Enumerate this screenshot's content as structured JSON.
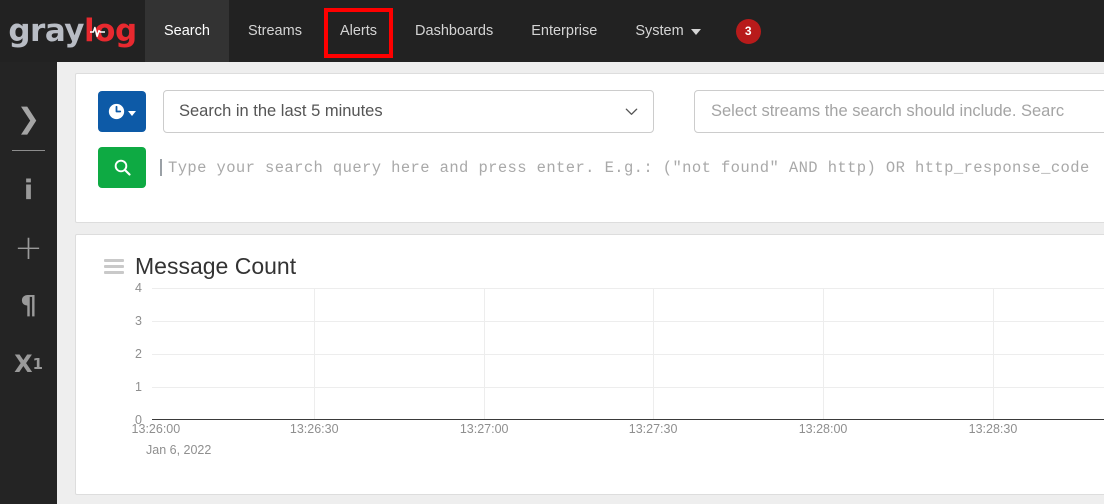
{
  "brand": {
    "name_part1": "gray",
    "name_part2": "log",
    "icon": "pulse-icon"
  },
  "nav": {
    "items": [
      {
        "label": "Search",
        "active": true,
        "annotated": false,
        "caret": false
      },
      {
        "label": "Streams",
        "active": false,
        "annotated": false,
        "caret": false
      },
      {
        "label": "Alerts",
        "active": false,
        "annotated": true,
        "caret": false
      },
      {
        "label": "Dashboards",
        "active": false,
        "annotated": false,
        "caret": false
      },
      {
        "label": "Enterprise",
        "active": false,
        "annotated": false,
        "caret": false
      },
      {
        "label": "System",
        "active": false,
        "annotated": false,
        "caret": true
      }
    ],
    "badge_count": "3",
    "badge_color": "#b81b1b",
    "annotation_color": "#ff0000",
    "background": "#222222",
    "active_background": "#333333"
  },
  "sidebar": {
    "items": [
      {
        "name": "expand-sidebar",
        "glyph": "❯"
      },
      {
        "name": "info",
        "glyph": "i"
      },
      {
        "name": "add",
        "glyph": "+"
      },
      {
        "name": "pilcrow",
        "glyph": "¶"
      },
      {
        "name": "subscript",
        "glyph": "X"
      }
    ],
    "subscript_value": "1"
  },
  "search": {
    "time_button": {
      "icon": "clock-icon",
      "color": "#0d5aa7"
    },
    "timerange_value": "Search in the last 5 minutes",
    "streams_placeholder": "Select streams the search should include. Searc",
    "search_button": {
      "icon": "search-icon",
      "color": "#0eaa43"
    },
    "query_value": "",
    "query_placeholder": "Type your search query here and press enter. E.g.: (\"not found\" AND http) OR http_response_code"
  },
  "widget": {
    "title": "Message Count",
    "drag_handle_icon": "drag-handle-icon"
  },
  "chart_data": {
    "type": "bar",
    "title": "Message Count",
    "xlabel": "",
    "ylabel": "",
    "x": [
      "13:26:00",
      "13:26:30",
      "13:27:00",
      "13:27:30",
      "13:28:00",
      "13:28:30"
    ],
    "x_tick_positions_pct": [
      0,
      16.9,
      34.6,
      52.2,
      69.9,
      87.6
    ],
    "categories": [
      "13:26:00",
      "13:26:30",
      "13:27:00",
      "13:27:30",
      "13:28:00",
      "13:28:30"
    ],
    "values": [
      0,
      0,
      0,
      0,
      0,
      0
    ],
    "yticks": [
      0,
      1,
      2,
      3,
      4
    ],
    "ylim": [
      0,
      4
    ],
    "date_label": "Jan 6, 2022",
    "grid": true,
    "legend": false,
    "empty": true
  }
}
